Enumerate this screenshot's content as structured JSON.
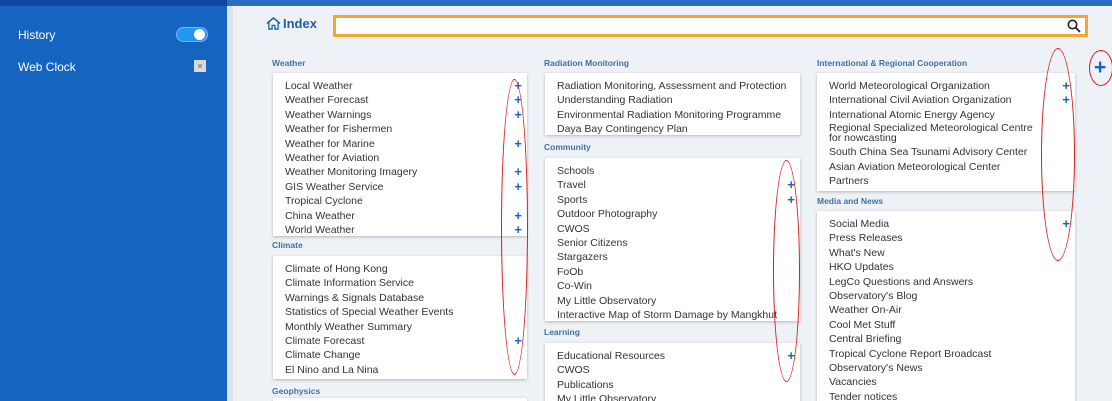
{
  "sidebar": {
    "items": [
      {
        "label": "History"
      },
      {
        "label": "Web Clock"
      }
    ],
    "close_glyph": "×"
  },
  "header": {
    "index_label": "Index",
    "search_placeholder": ""
  },
  "plus_glyph": "+",
  "columns": {
    "weather": {
      "title": "Weather",
      "items": [
        "Local Weather",
        "Weather Forecast",
        "Weather Warnings",
        "Weather for Fishermen",
        "Weather for Marine",
        "Weather for Aviation",
        "Weather Monitoring Imagery",
        "GIS Weather Service",
        "Tropical Cyclone",
        "China Weather",
        "World Weather"
      ]
    },
    "climate": {
      "title": "Climate",
      "items": [
        "Climate of Hong Kong",
        "Climate Information Service",
        "Warnings & Signals Database",
        "Statistics of Special Weather Events",
        "Monthly Weather Summary",
        "Climate Forecast",
        "Climate Change",
        "El Nino and La Nina"
      ]
    },
    "geophysics": {
      "title": "Geophysics"
    },
    "radiation": {
      "title": "Radiation Monitoring",
      "items": [
        "Radiation Monitoring, Assessment and Protection",
        "Understanding Radiation",
        "Environmental Radiation Monitoring Programme",
        "Daya Bay Contingency Plan"
      ]
    },
    "community": {
      "title": "Community",
      "items": [
        "Schools",
        "Travel",
        "Sports",
        "Outdoor Photography",
        "CWOS",
        "Senior Citizens",
        "Stargazers",
        "FoOb",
        "Co-Win",
        "My Little Observatory",
        "Interactive Map of Storm Damage by Mangkhut"
      ]
    },
    "learning": {
      "title": "Learning",
      "items": [
        "Educational Resources",
        "CWOS",
        "Publications",
        "My Little Observatory"
      ]
    },
    "international": {
      "title": "International & Regional Cooperation",
      "items": [
        "World Meteorological Organization",
        "International Civil Aviation Organization",
        "International Atomic Energy Agency",
        "Regional Specialized Meteorological Centre for nowcasting",
        "South China Sea Tsunami Advisory Center",
        "Asian Aviation Meteorological Center",
        "Partners"
      ]
    },
    "media": {
      "title": "Media and News",
      "items": [
        "Social Media",
        "Press Releases",
        "What's New",
        "HKO Updates",
        "LegCo Questions and Answers",
        "Observatory's Blog",
        "Weather On-Air",
        "Cool Met Stuff",
        "Central Briefing",
        "Tropical Cyclone Report Broadcast",
        "Observatory's News",
        "Vacancies",
        "Tender notices"
      ]
    }
  },
  "colors": {
    "sidebar": "#1565c0",
    "accent": "#1565c0",
    "search_border": "#f3a531",
    "annotation": "#d71e1e"
  }
}
